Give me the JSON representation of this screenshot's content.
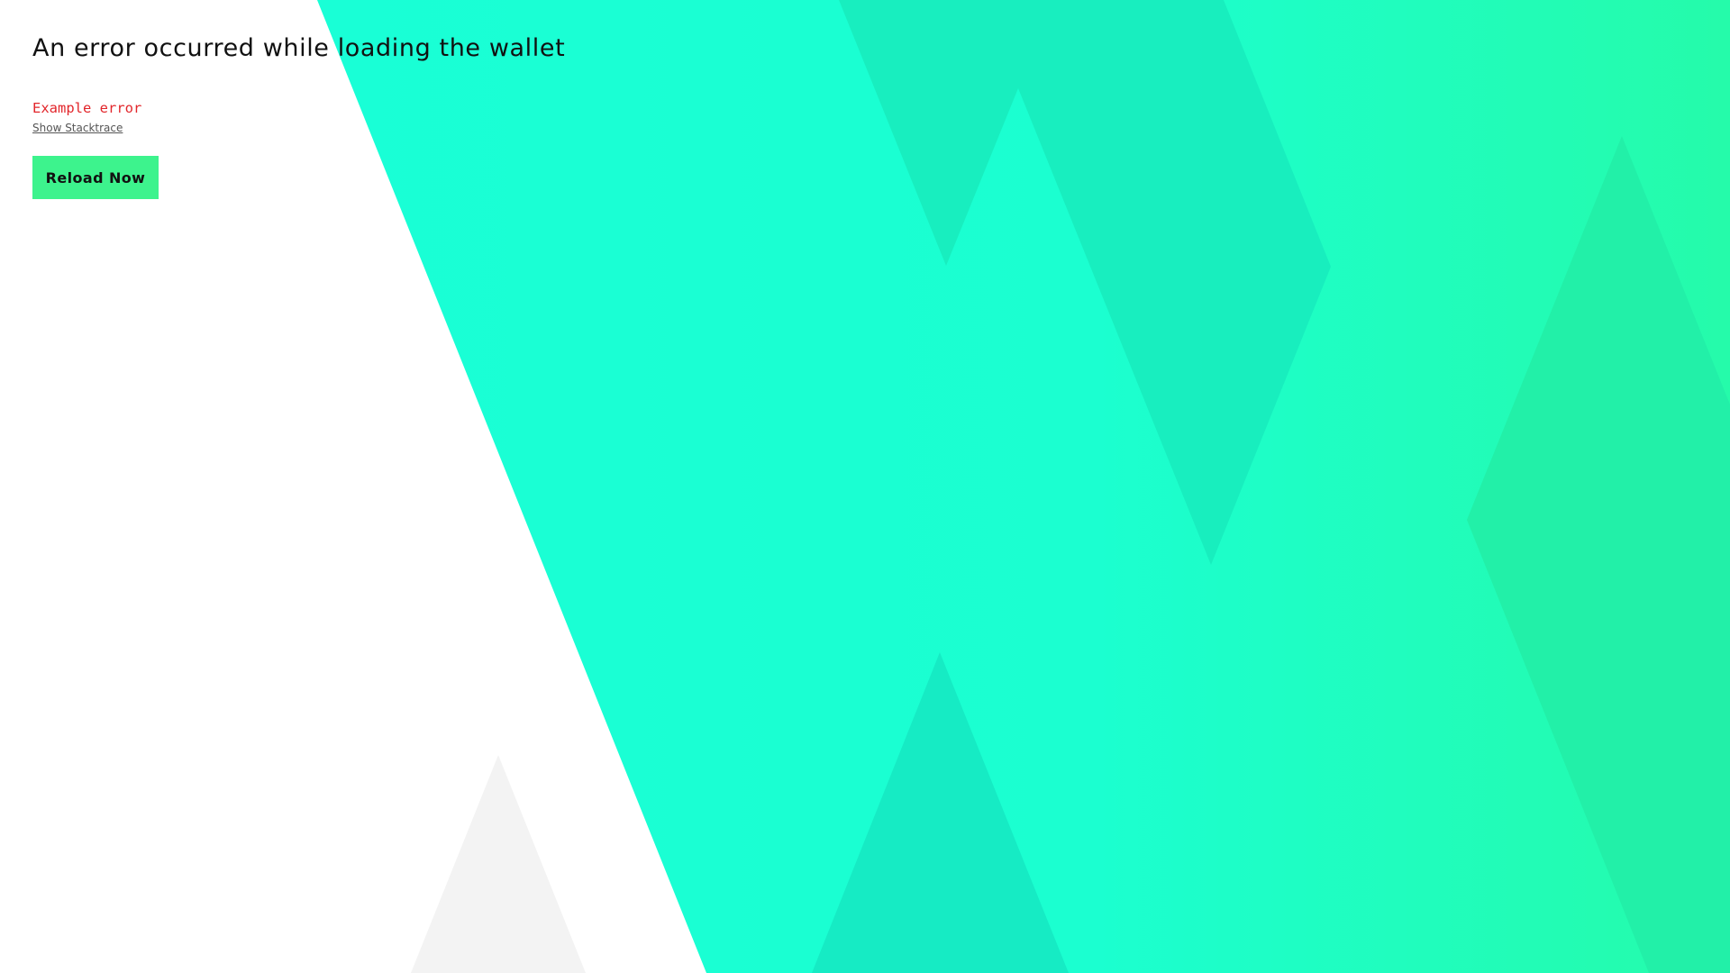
{
  "error_screen": {
    "title": "An error occurred while loading the wallet",
    "error_message": "Example error",
    "stacktrace_link": "Show Stacktrace",
    "reload_button": "Reload Now"
  },
  "colors": {
    "background": "#ffffff",
    "accent_teal": "#19ffd6",
    "accent_green": "#3df38d",
    "error_red": "#e2262b"
  }
}
